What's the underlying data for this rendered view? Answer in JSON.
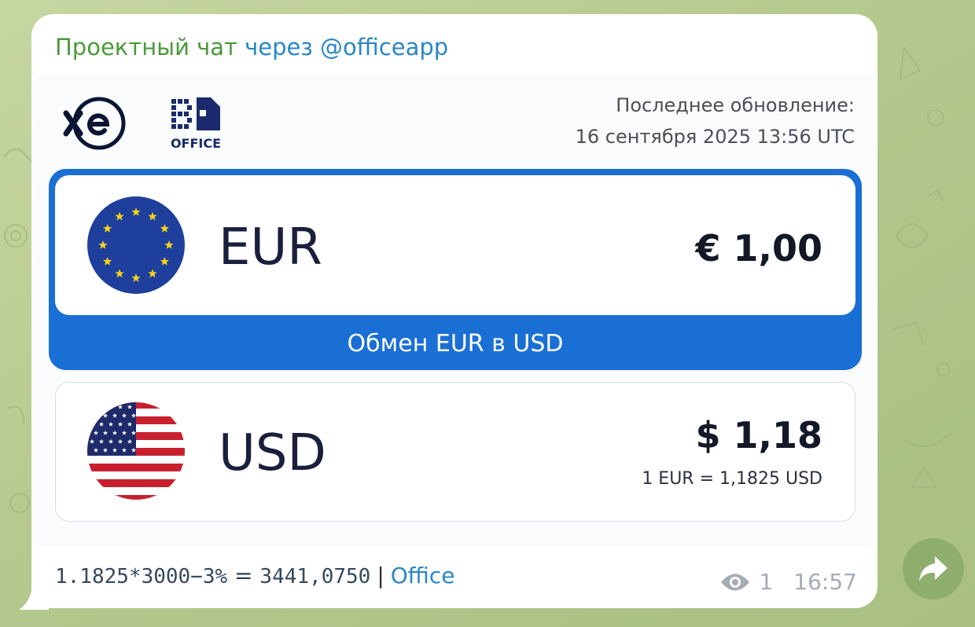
{
  "header": {
    "sender": "Проектный чат",
    "via": "через @officeapp"
  },
  "card": {
    "update_label": "Последнее обновление:",
    "update_date": "16 сентября 2025 13:56 UTC",
    "from": {
      "code": "EUR",
      "amount": "€ 1,00",
      "flag_icon": "eu-flag-icon"
    },
    "convert_button": "Обмен EUR в USD",
    "to": {
      "code": "USD",
      "amount": "$ 1,18",
      "rate": "1 EUR = 1,1825 USD",
      "flag_icon": "us-flag-icon"
    }
  },
  "message": {
    "calc_text": "1.1825*3000−3%",
    "equals": " = ",
    "result": "3441,0750",
    "separator": "|",
    "link": "Office",
    "views": "1",
    "time": "16:57"
  },
  "colors": {
    "accent_blue": "#1a6fd4",
    "sender_green": "#4a9a3a",
    "link_blue": "#2a86c6",
    "wallpaper": "#b6c98e"
  }
}
